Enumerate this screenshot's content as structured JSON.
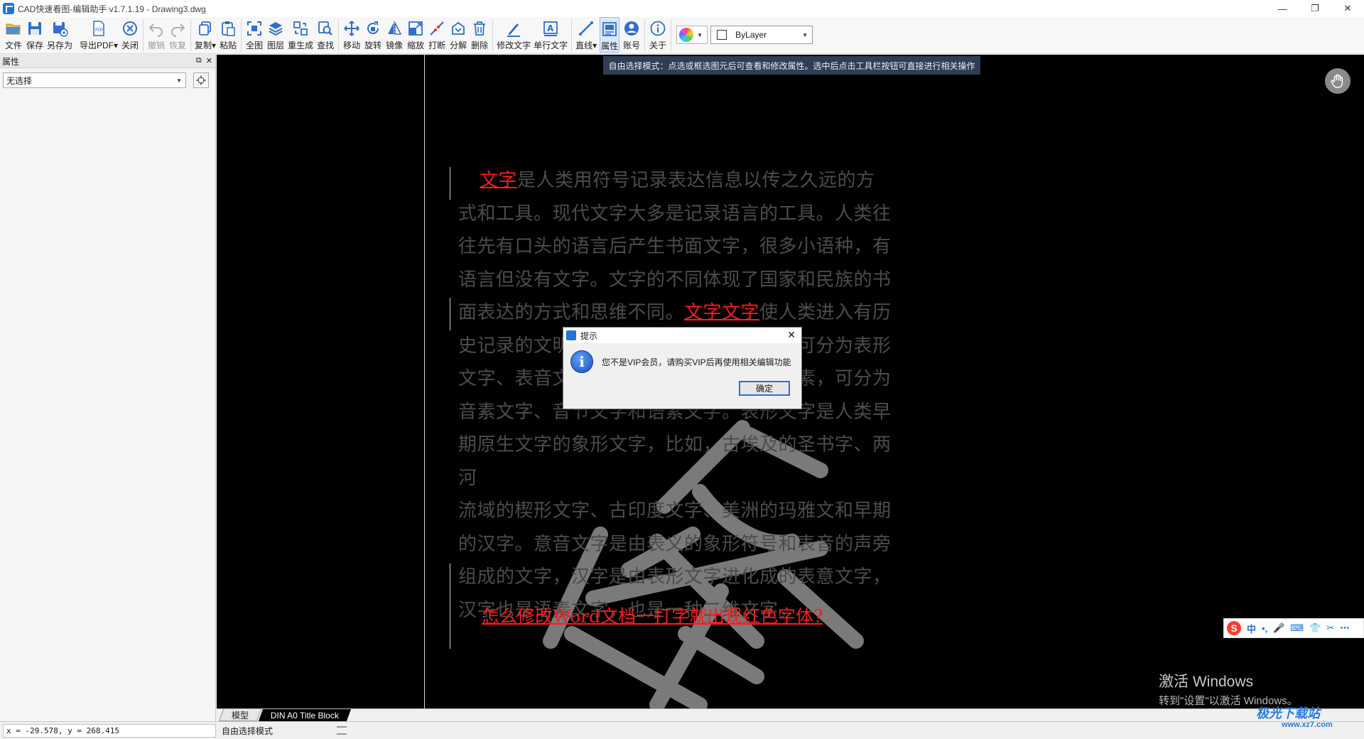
{
  "window": {
    "title": "CAD快速看图-编辑助手 v1.7.1.19 - Drawing3.dwg",
    "controls": [
      "—",
      "❐",
      "✕"
    ]
  },
  "toolbar": {
    "items": [
      {
        "label": "文件",
        "icon": "folder-icon"
      },
      {
        "label": "保存",
        "icon": "save-icon"
      },
      {
        "label": "另存为",
        "icon": "save-as-icon"
      },
      {
        "label": "导出PDF▾",
        "icon": "pdf-export-icon"
      },
      {
        "label": "关闭",
        "icon": "close-circle-icon"
      },
      {
        "label": "撤销",
        "icon": "undo-icon"
      },
      {
        "label": "恢复",
        "icon": "redo-icon"
      },
      {
        "label": "复制▾",
        "icon": "copy-icon"
      },
      {
        "label": "粘贴",
        "icon": "paste-icon"
      },
      {
        "label": "全图",
        "icon": "zoom-extents-icon"
      },
      {
        "label": "图层",
        "icon": "layers-icon"
      },
      {
        "label": "重生成",
        "icon": "regen-icon"
      },
      {
        "label": "查找",
        "icon": "find-icon"
      },
      {
        "label": "移动",
        "icon": "move-icon"
      },
      {
        "label": "旋转",
        "icon": "rotate-icon"
      },
      {
        "label": "镜像",
        "icon": "mirror-icon"
      },
      {
        "label": "缩放",
        "icon": "scale-icon"
      },
      {
        "label": "打断",
        "icon": "break-icon"
      },
      {
        "label": "分解",
        "icon": "explode-icon"
      },
      {
        "label": "删除",
        "icon": "trash-icon"
      },
      {
        "label": "修改文字",
        "icon": "edit-text-icon"
      },
      {
        "label": "单行文字",
        "icon": "single-text-icon"
      },
      {
        "label": "直线▾",
        "icon": "line-icon"
      },
      {
        "label": "属性",
        "icon": "properties-icon"
      },
      {
        "label": "账号",
        "icon": "account-icon"
      },
      {
        "label": "关于",
        "icon": "info-icon"
      }
    ],
    "layer_value": "ByLayer"
  },
  "panel": {
    "title": "属性",
    "selection": "无选择"
  },
  "canvas": {
    "hint": "自由选择模式：点选或框选图元后可查看和修改属性。选中后点击工具栏按钮可直接进行相关操作",
    "text_lines": [
      {
        "red": "文字",
        "rest": "是人类用符号记录表达信息以传之久远的方",
        "indent": true
      },
      {
        "red": "",
        "rest": "式和工具。现代文字大多是记录语言的工具。人类往"
      },
      {
        "red": "",
        "rest": "往先有口头的语言后产生书面文字，很多小语种，有"
      },
      {
        "red": "",
        "rest": "语言但没有文字。文字的不同体现了国家和民族的书"
      },
      {
        "pre": "面表达的方式和思维不同。",
        "red": "文字文字",
        "rest": "使人类进入有历"
      },
      {
        "red": "",
        "rest": "史记录的文明社会。文字按字音和字形，可分为表形"
      },
      {
        "red": "",
        "rest": "文字、表音文字和意音文字。按语音和语素，可分为"
      },
      {
        "red": "",
        "rest": "音素文字、音节文字和语素文字。表形文字是人类早"
      },
      {
        "red": "",
        "rest": "期原生文字的象形文字，比如，古埃及的圣书字、两河"
      },
      {
        "red": "",
        "rest": "流域的楔形文字、古印度文字、美洲的玛雅文和早期"
      },
      {
        "red": "",
        "rest": "的汉字。意音文字是由表义的象形符号和表音的声旁"
      },
      {
        "red": "",
        "rest": "组成的文字，汉字是由表形文字进化成的表意文字，"
      },
      {
        "red": "",
        "rest": "汉字也是语素文字，也是一种二维文字。"
      }
    ],
    "question": "怎么修改Word文档一打字就出现红色字体?",
    "windows_watermark_1": "激活 Windows",
    "windows_watermark_2": "转到\"设置\"以激活 Windows。"
  },
  "tabs": {
    "model": "模型",
    "layout": "DIN A0 Title Block"
  },
  "status": {
    "coords": "x = -29.578,  y = 268.415",
    "mode": "自由选择模式"
  },
  "dialog": {
    "title": "提示",
    "message": "您不是VIP会员，请购买VIP后再使用相关编辑功能",
    "ok": "确定"
  },
  "ime": {
    "logo": "S",
    "items": [
      "中",
      "•,",
      "🎤",
      "⌨",
      "👕",
      "✂",
      "⋯"
    ]
  },
  "site_watermark": {
    "name": "极光下载站",
    "url": "www.xz7.com"
  },
  "colors": {
    "accent": "#1e74d8",
    "red_text": "#ff1a1a",
    "canvas_bg": "#000000",
    "hint_bg": "#2f3d55"
  }
}
